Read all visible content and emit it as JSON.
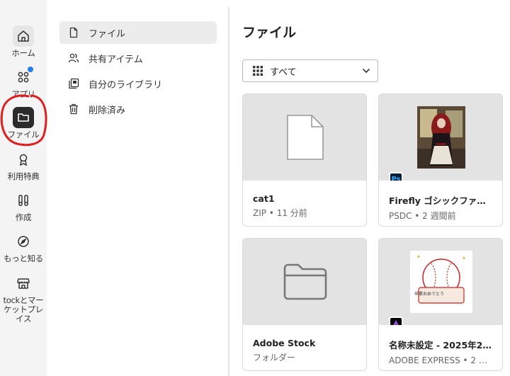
{
  "rail": {
    "items": [
      {
        "label": "ホーム",
        "icon": "home-icon"
      },
      {
        "label": "アプリ",
        "icon": "apps-icon"
      },
      {
        "label": "ファイル",
        "icon": "folder-icon"
      },
      {
        "label": "利用特典",
        "icon": "award-icon"
      },
      {
        "label": "作成",
        "icon": "create-icon"
      },
      {
        "label": "もっと知る",
        "icon": "compass-icon"
      },
      {
        "label": "tockとマーケットプレイス",
        "icon": "store-icon"
      }
    ],
    "active": "ファイル",
    "annotation_color": "#e01e1e"
  },
  "nav": {
    "items": [
      {
        "label": "ファイル",
        "icon": "file-icon"
      },
      {
        "label": "共有アイテム",
        "icon": "shared-icon"
      },
      {
        "label": "自分のライブラリ",
        "icon": "library-icon"
      },
      {
        "label": "削除済み",
        "icon": "trash-icon"
      }
    ]
  },
  "main": {
    "title": "ファイル",
    "filter": {
      "selected": "すべて"
    },
    "cards": [
      {
        "name": "cat1",
        "meta": "ZIP • 11 分前",
        "thumb": "file-icon"
      },
      {
        "name": "Firefly ゴシックファ…",
        "meta": "PSDC • 2 週間前",
        "thumb": "image",
        "badge": "Ps"
      },
      {
        "name": "Adobe Stock",
        "meta": "フォルダー",
        "thumb": "folder-icon"
      },
      {
        "name": "名称未設定 - 2025年2…",
        "meta": "ADOBE EXPRESS • 2 か…",
        "thumb": "image",
        "badge": "Express"
      }
    ]
  }
}
